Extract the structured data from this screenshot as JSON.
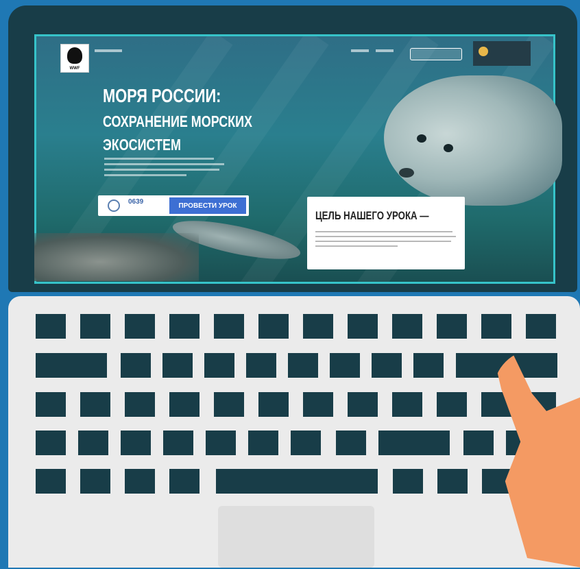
{
  "screen": {
    "title": "МОРЯ РОССИИ:",
    "subtitle_line1": "СОХРАНЕНИЕ МОРСКИХ",
    "subtitle_line2": "ЭКОСИСТЕМ",
    "counter": "0639",
    "start_button": "ПРОВЕСТИ УРОК",
    "goal_heading": "ЦЕЛЬ НАШЕГО УРОКА —",
    "logo_text": "WWF"
  },
  "colors": {
    "background": "#1f78b4",
    "laptop_dark": "#183d48",
    "screen_border": "#36c3c9",
    "keyboard_base": "#ebebeb",
    "hand": "#f49a63",
    "cta": "#3d6fd3"
  }
}
